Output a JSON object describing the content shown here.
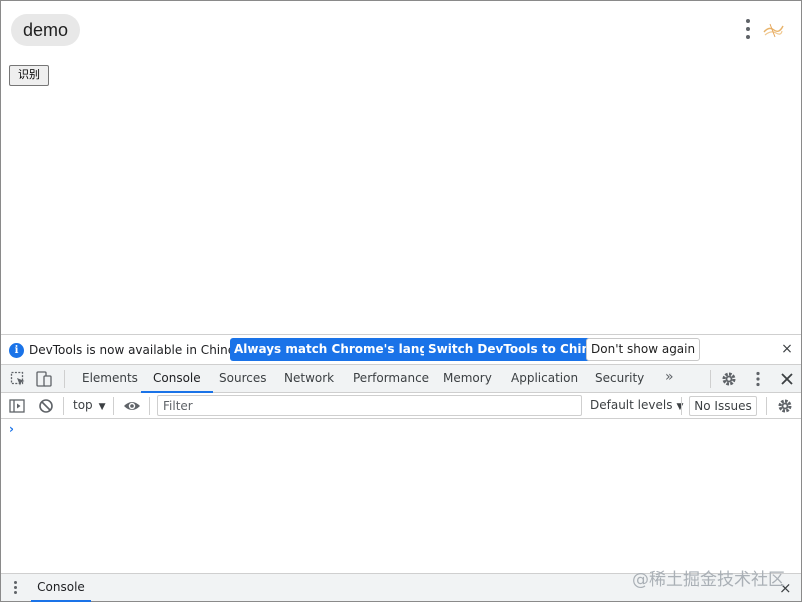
{
  "page": {
    "tab_title": "demo",
    "recognize_button": "识别"
  },
  "devtools": {
    "infobar": {
      "message": "DevTools is now available in Chinese!",
      "match_language_label": "Always match Chrome's language",
      "switch_label": "Switch DevTools to Chinese",
      "dismiss_label": "Don't show again",
      "close_glyph": "×"
    },
    "tabs": [
      {
        "label": "Elements",
        "active": false
      },
      {
        "label": "Console",
        "active": true
      },
      {
        "label": "Sources",
        "active": false
      },
      {
        "label": "Network",
        "active": false
      },
      {
        "label": "Performance",
        "active": false
      },
      {
        "label": "Memory",
        "active": false
      },
      {
        "label": "Application",
        "active": false
      },
      {
        "label": "Security",
        "active": false
      }
    ],
    "more_tabs_glyph": "»",
    "toolbar": {
      "context": "top",
      "filter_placeholder": "Filter",
      "levels": "Default levels",
      "issues": "No Issues"
    },
    "console": {
      "prompt": "›"
    },
    "drawer": {
      "tab": "Console",
      "close_glyph": "×"
    },
    "accent_color": "#1a73e8"
  },
  "watermark": "@稀土掘金技术社区"
}
